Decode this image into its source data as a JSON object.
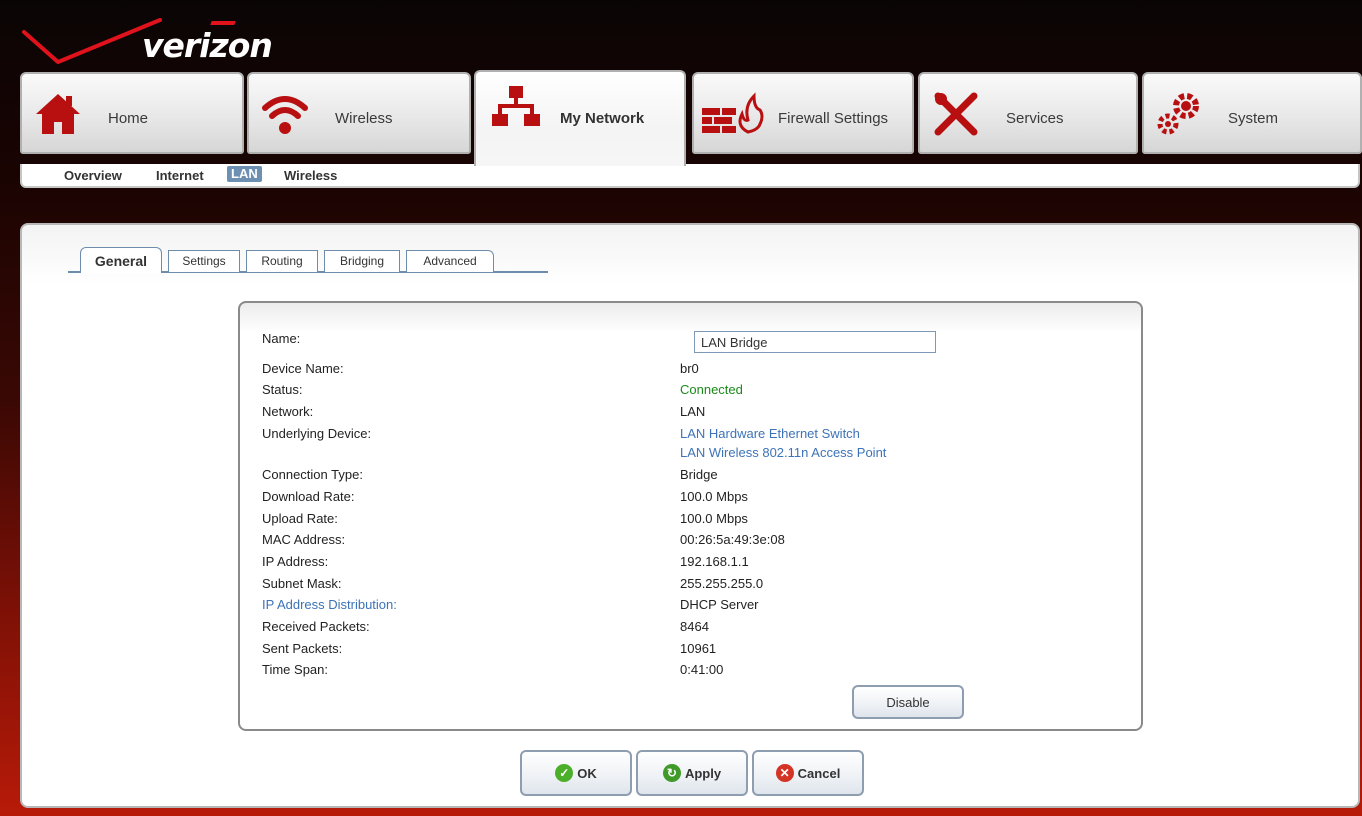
{
  "brand": {
    "logo_text_pre": "veri",
    "logo_text_z": "z",
    "logo_text_post": "on"
  },
  "nav": {
    "tabs": [
      {
        "label": "Home",
        "icon": "home-icon"
      },
      {
        "label": "Wireless",
        "icon": "wifi-icon"
      },
      {
        "label": "My Network",
        "icon": "network-icon",
        "active": true
      },
      {
        "label": "Firewall Settings",
        "icon": "firewall-icon"
      },
      {
        "label": "Services",
        "icon": "tools-icon"
      },
      {
        "label": "System",
        "icon": "gears-icon"
      }
    ]
  },
  "subnav": {
    "items": [
      {
        "label": "Overview"
      },
      {
        "label": "Internet"
      },
      {
        "label": "LAN",
        "active": true
      },
      {
        "label": "Wireless"
      }
    ]
  },
  "subtabs": [
    {
      "label": "General",
      "active": true
    },
    {
      "label": "Settings"
    },
    {
      "label": "Routing"
    },
    {
      "label": "Bridging"
    },
    {
      "label": "Advanced"
    }
  ],
  "details": {
    "name_label": "Name:",
    "name_value": "LAN Bridge",
    "rows": [
      {
        "label": "Device Name:",
        "value": "br0"
      },
      {
        "label": "Status:",
        "value": "Connected"
      },
      {
        "label": "Network:",
        "value": "LAN"
      },
      {
        "label": "Underlying Device:",
        "value": "LAN Hardware Ethernet Switch",
        "value2": "LAN Wireless 802.11n Access Point"
      },
      {
        "label": "Connection Type:",
        "value": "Bridge"
      },
      {
        "label": "Download Rate:",
        "value": "100.0 Mbps"
      },
      {
        "label": "Upload Rate:",
        "value": "100.0 Mbps"
      },
      {
        "label": "MAC Address:",
        "value": "00:26:5a:49:3e:08"
      },
      {
        "label": "IP Address:",
        "value": "192.168.1.1"
      },
      {
        "label": "Subnet Mask:",
        "value": "255.255.255.0"
      },
      {
        "label": "IP Address Distribution:",
        "value": "DHCP Server"
      },
      {
        "label": "Received Packets:",
        "value": "8464"
      },
      {
        "label": "Sent Packets:",
        "value": "10961"
      },
      {
        "label": "Time Span:",
        "value": "0:41:00"
      }
    ],
    "disable_label": "Disable"
  },
  "actions": {
    "ok_label": "OK",
    "apply_label": "Apply",
    "cancel_label": "Cancel"
  },
  "colors": {
    "link": "#3d73b8",
    "connected": "#1a8a1a",
    "brand_red": "#e0121b",
    "subnav_active": "#6c8fb2"
  }
}
